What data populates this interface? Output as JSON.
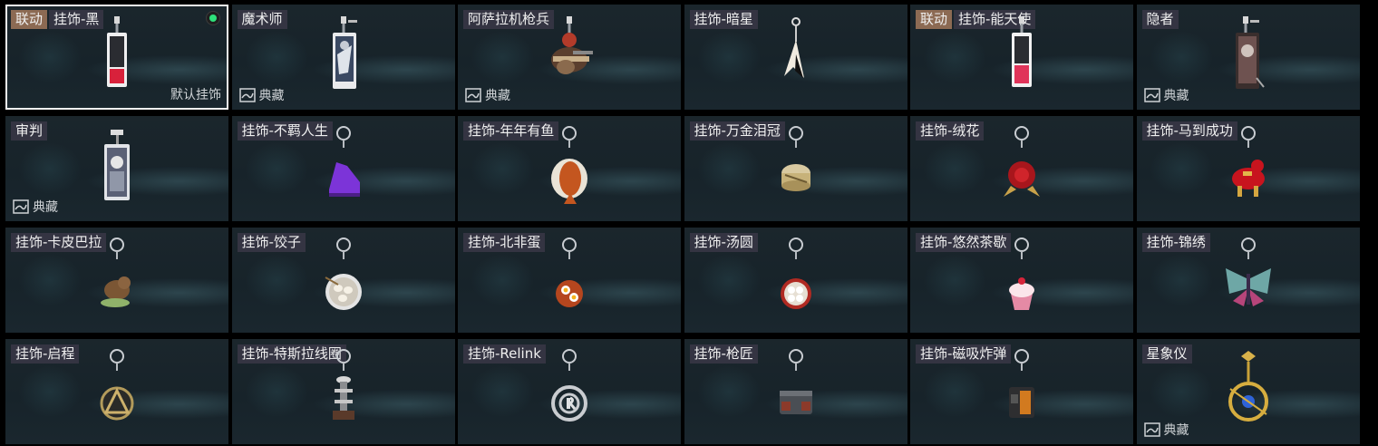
{
  "items": [
    {
      "tags": [
        "联动",
        "挂饰-黑"
      ],
      "collab": true,
      "selected": true,
      "equipped": true,
      "default_label": "默认挂饰",
      "icon": "black-card-charm-icon"
    },
    {
      "tags": [
        "魔术师"
      ],
      "collection_label": "典藏",
      "icon": "magician-card-charm-icon"
    },
    {
      "tags": [
        "阿萨拉机枪兵"
      ],
      "collection_label": "典藏",
      "icon": "gunner-figure-charm-icon"
    },
    {
      "tags": [
        "挂饰-暗星"
      ],
      "icon": "dark-star-charm-icon"
    },
    {
      "tags": [
        "联动",
        "挂饰-能天使"
      ],
      "collab": true,
      "icon": "exusiai-card-charm-icon"
    },
    {
      "tags": [
        "隐者"
      ],
      "collection_label": "典藏",
      "icon": "hermit-card-charm-icon"
    },
    {
      "tags": [
        "审判"
      ],
      "collection_label": "典藏",
      "icon": "judgement-card-charm-icon"
    },
    {
      "tags": [
        "挂饰-不羁人生"
      ],
      "icon": "purple-sneaker-charm-icon"
    },
    {
      "tags": [
        "挂饰-年年有鱼"
      ],
      "icon": "fish-plate-charm-icon"
    },
    {
      "tags": [
        "挂饰-万金泪冠"
      ],
      "icon": "gold-crown-charm-icon"
    },
    {
      "tags": [
        "挂饰-绒花"
      ],
      "icon": "red-flower-charm-icon"
    },
    {
      "tags": [
        "挂饰-马到成功"
      ],
      "icon": "red-horse-charm-icon"
    },
    {
      "tags": [
        "挂饰-卡皮巴拉"
      ],
      "icon": "capybara-charm-icon"
    },
    {
      "tags": [
        "挂饰-饺子"
      ],
      "icon": "dumplings-charm-icon"
    },
    {
      "tags": [
        "挂饰-北非蛋"
      ],
      "icon": "shakshuka-charm-icon"
    },
    {
      "tags": [
        "挂饰-汤圆"
      ],
      "icon": "tangyuan-charm-icon"
    },
    {
      "tags": [
        "挂饰-悠然茶歇"
      ],
      "icon": "cupcake-charm-icon"
    },
    {
      "tags": [
        "挂饰-锦绣"
      ],
      "icon": "butterfly-charm-icon"
    },
    {
      "tags": [
        "挂饰-启程"
      ],
      "icon": "triangle-medal-charm-icon"
    },
    {
      "tags": [
        "挂饰-特斯拉线圈"
      ],
      "icon": "tesla-coil-charm-icon"
    },
    {
      "tags": [
        "挂饰-Relink"
      ],
      "icon": "relink-emblem-charm-icon"
    },
    {
      "tags": [
        "挂饰-枪匠"
      ],
      "icon": "gunsmith-box-charm-icon"
    },
    {
      "tags": [
        "挂饰-磁吸炸弹"
      ],
      "icon": "magnetic-bomb-charm-icon"
    },
    {
      "tags": [
        "星象仪"
      ],
      "collection_label": "典藏",
      "icon": "astrolabe-charm-icon"
    }
  ],
  "colors": {
    "collab_tag": "#8c6a53",
    "name_tag": "#3a3746",
    "equipped_dot": "#2ee07a",
    "selected_border": "#f2f2f2"
  }
}
